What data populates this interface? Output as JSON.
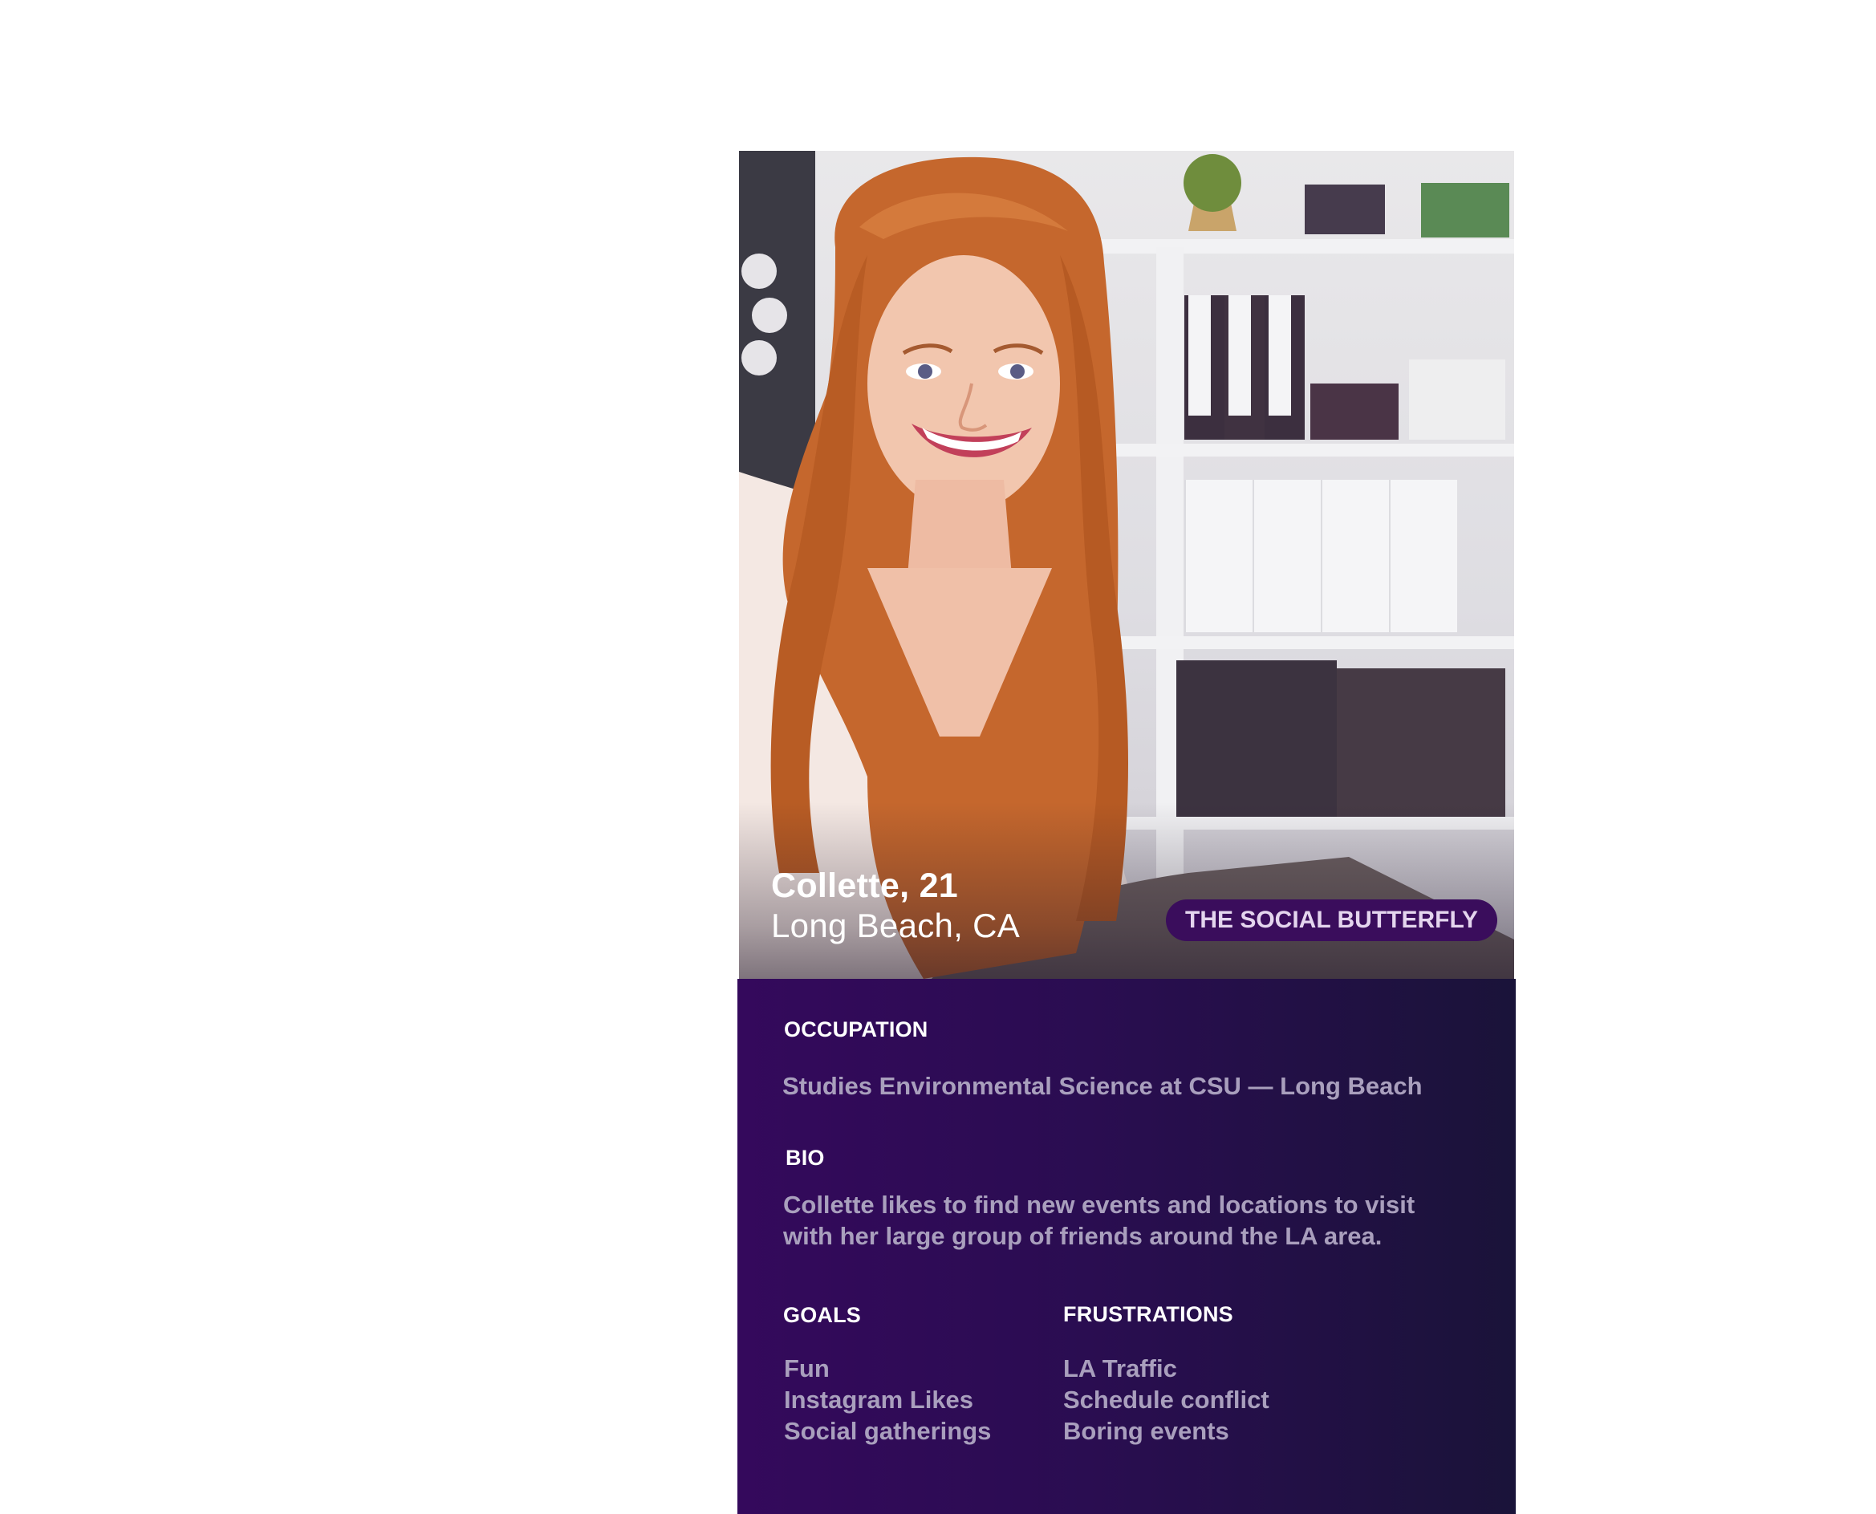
{
  "persona": {
    "name_age": "Collette, 21",
    "location": "Long Beach, CA",
    "archetype": "THE SOCIAL BUTTERFLY"
  },
  "occupation": {
    "heading": "OCCUPATION",
    "text": "Studies Environmental Science at CSU  — Long Beach"
  },
  "bio": {
    "heading": "BIO",
    "lines": [
      "Collette likes to find new events and locations to visit",
      "with her large group of friends around the LA area."
    ]
  },
  "goals": {
    "heading": "GOALS",
    "items": [
      "Fun",
      "Instagram Likes",
      "Social gatherings"
    ]
  },
  "frustrations": {
    "heading": "FRUSTRATIONS",
    "items": [
      "LA Traffic",
      "Schedule conflict",
      "Boring events"
    ]
  },
  "colors": {
    "panel_start": "#34095c",
    "panel_end": "#1a1339",
    "badge_bg": "#3a0d5c",
    "muted_text": "#a99fbd"
  }
}
